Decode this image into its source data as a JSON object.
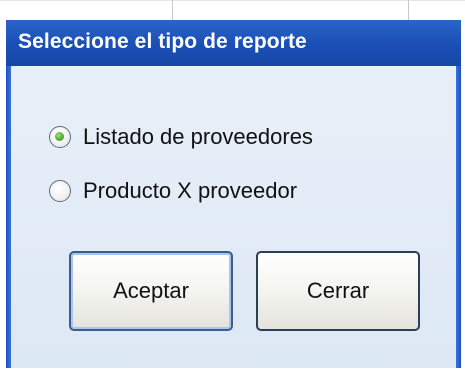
{
  "dialog": {
    "title": "Seleccione el tipo de reporte",
    "options": [
      {
        "label": "Listado de proveedores",
        "selected": true
      },
      {
        "label": "Producto X proveedor",
        "selected": false
      }
    ],
    "buttons": {
      "accept_label": "Aceptar",
      "close_label": "Cerrar"
    }
  },
  "colors": {
    "titlebar": "#1a4fb5",
    "client_bg": "#dfe9f5",
    "radio_selected": "#4cae2c"
  }
}
